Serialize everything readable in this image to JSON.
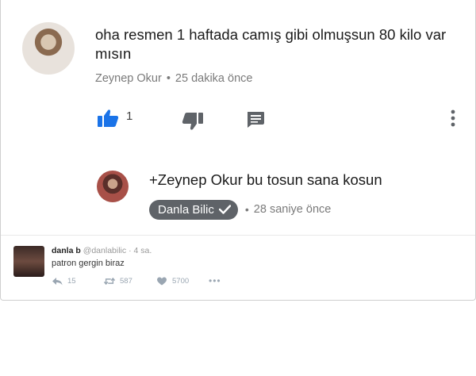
{
  "comment": {
    "text": "oha resmen 1 haftada camış gibi olmuşsun 80 kilo var mısın",
    "author": "Zeynep Okur",
    "separator": "•",
    "time": "25 dakika önce",
    "likes": "1"
  },
  "reply": {
    "text": "+Zeynep Okur bu tosun sana kosun",
    "author": "Danla Bilic",
    "separator": "•",
    "time": "28 saniye önce"
  },
  "tweet": {
    "name": "danla b",
    "handle": "@danlabilic",
    "separator": "·",
    "time": "4 sa.",
    "text": "patron gergin biraz",
    "replies": "15",
    "retweets": "587",
    "likes": "5700",
    "more": "•••"
  },
  "colors": {
    "like_active": "#1a73e8",
    "icon_dark": "#5f6368",
    "chip_bg": "#5f6368",
    "tweet_icon": "#9aa6b2"
  }
}
